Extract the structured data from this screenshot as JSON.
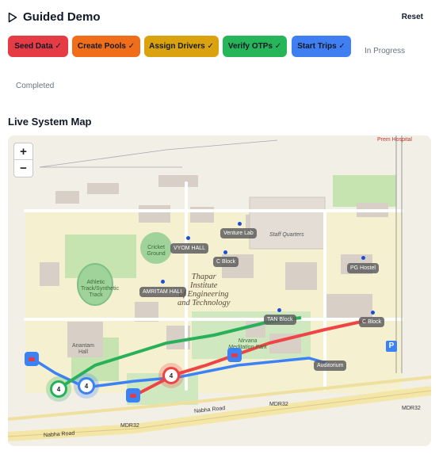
{
  "header": {
    "title": "Guided Demo",
    "reset_label": "Reset"
  },
  "steps": [
    {
      "label": "Seed Data ✓",
      "color": "#e53b45"
    },
    {
      "label": "Create Pools ✓",
      "color": "#f06d1a"
    },
    {
      "label": "Assign Drivers ✓",
      "color": "#d9a20e"
    },
    {
      "label": "Verify OTPs ✓",
      "color": "#27b55a"
    },
    {
      "label": "Start Trips ✓",
      "color": "#3f7ff2"
    }
  ],
  "status": {
    "in_progress": "In Progress",
    "completed": "Completed"
  },
  "map": {
    "heading": "Live System Map",
    "zoom_in": "+",
    "zoom_out": "−",
    "campus_name": [
      "Thapar",
      "Institute",
      "of Engineering",
      "and Technology"
    ],
    "buildings": [
      "Venture Lab",
      "VYOM HALL",
      "C Block",
      "PG Hostel",
      "AMRITAM HALL",
      "TAN Block",
      "C Block",
      "Auditorium"
    ],
    "other_labels": {
      "staff_quarters": "Staff Quarters",
      "cricket_ground": "Cricket Ground",
      "athletic_track": "Athletic Track/Synthetic Track",
      "anantam_hall": "Anantam Hall",
      "nirvana": "Nirvana Meditation Park",
      "prem_hospital": "Prem Hospital",
      "road_1": "Nabha Road",
      "road_2": "Nabha Road",
      "road_3": "MDR32",
      "road_4": "MDR32",
      "road_5": "MDR32",
      "parking": "P"
    },
    "markers": [
      {
        "count": "4",
        "color": "green"
      },
      {
        "count": "4",
        "color": "blue"
      },
      {
        "count": "4",
        "color": "red"
      }
    ],
    "route_colors": {
      "green": "#29b05a",
      "blue": "#3b82f6",
      "red": "#ef4444"
    }
  }
}
